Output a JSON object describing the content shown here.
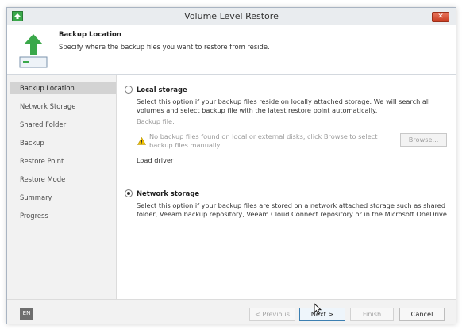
{
  "window": {
    "title": "Volume Level Restore",
    "close_label": "✕"
  },
  "header": {
    "title": "Backup Location",
    "subtitle": "Specify where the backup files you want to restore from reside."
  },
  "sidebar": {
    "items": [
      {
        "label": "Backup Location",
        "active": true
      },
      {
        "label": "Network Storage",
        "active": false
      },
      {
        "label": "Shared Folder",
        "active": false
      },
      {
        "label": "Backup",
        "active": false
      },
      {
        "label": "Restore Point",
        "active": false
      },
      {
        "label": "Restore Mode",
        "active": false
      },
      {
        "label": "Summary",
        "active": false
      },
      {
        "label": "Progress",
        "active": false
      }
    ]
  },
  "local_storage": {
    "label": "Local storage",
    "selected": false,
    "description": "Select this option if your backup files reside on locally attached storage. We will search all volumes and select backup file with the latest restore point automatically.",
    "backup_file_label": "Backup file:",
    "warning_text": "No backup files found on local or external disks, click Browse to select backup files manually",
    "browse_label": "Browse...",
    "load_driver_label": "Load driver"
  },
  "network_storage": {
    "label": "Network storage",
    "selected": true,
    "description": "Select this option if your backup files are stored on a network attached storage such as shared folder, Veeam backup repository, Veeam Cloud Connect repository or in the Microsoft OneDrive."
  },
  "footer": {
    "language": "EN",
    "previous_label": "< Previous",
    "next_label": "Next >",
    "finish_label": "Finish",
    "cancel_label": "Cancel"
  },
  "colors": {
    "accent_green": "#3aa84a",
    "close_red": "#c83b20",
    "warning_yellow": "#f2c200"
  },
  "icons": {
    "app": "restore-app-icon",
    "header": "upload-arrow-icon",
    "warning": "warning-icon",
    "cursor": "mouse-cursor-icon"
  }
}
